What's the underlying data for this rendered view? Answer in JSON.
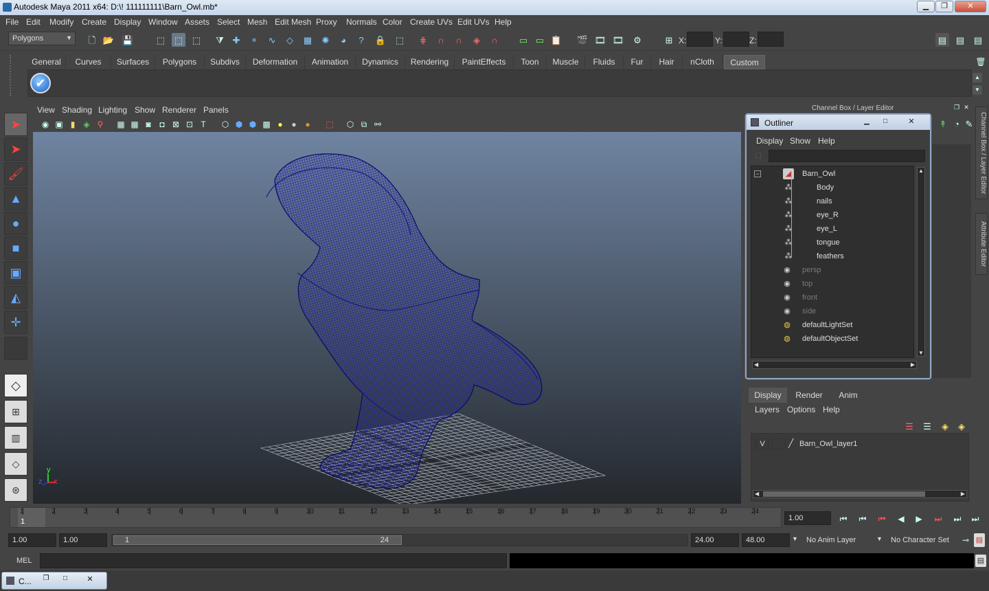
{
  "window": {
    "title": "Autodesk Maya 2011 x64: D:\\! 111111111\\Barn_Owl.mb*",
    "minimize": "▁",
    "maximize": "❐",
    "close": "✕"
  },
  "menubar": [
    "File",
    "Edit",
    "Modify",
    "Create",
    "Display",
    "Window",
    "Assets",
    "Select",
    "Mesh",
    "Edit Mesh",
    "Proxy",
    "Normals",
    "Color",
    "Create UVs",
    "Edit UVs",
    "Help"
  ],
  "statusline": {
    "mode": "Polygons",
    "x_label": "X:",
    "y_label": "Y:",
    "z_label": "Z:"
  },
  "shelf": {
    "tabs": [
      "General",
      "Curves",
      "Surfaces",
      "Polygons",
      "Subdivs",
      "Deformation",
      "Animation",
      "Dynamics",
      "Rendering",
      "PaintEffects",
      "Toon",
      "Muscle",
      "Fluids",
      "Fur",
      "Hair",
      "nCloth",
      "Custom"
    ],
    "active_tab": "Custom"
  },
  "viewport": {
    "menus": [
      "View",
      "Shading",
      "Lighting",
      "Show",
      "Renderer",
      "Panels"
    ],
    "axis_y": "y",
    "axis_x": "x",
    "axis_z": "z",
    "wire_color": "#0d0d6e"
  },
  "outliner": {
    "title": "Outliner",
    "menus": [
      "Display",
      "Show",
      "Help"
    ],
    "items": [
      {
        "label": "Barn_Owl",
        "dim": false
      },
      {
        "label": "Body",
        "dim": false
      },
      {
        "label": "nails",
        "dim": false
      },
      {
        "label": "eye_R",
        "dim": false
      },
      {
        "label": "eye_L",
        "dim": false
      },
      {
        "label": "tongue",
        "dim": false
      },
      {
        "label": "feathers",
        "dim": false
      },
      {
        "label": "persp",
        "dim": true
      },
      {
        "label": "top",
        "dim": true
      },
      {
        "label": "front",
        "dim": true
      },
      {
        "label": "side",
        "dim": true
      },
      {
        "label": "defaultLightSet",
        "dim": false
      },
      {
        "label": "defaultObjectSet",
        "dim": false
      }
    ]
  },
  "channelbox": {
    "title": "Channel Box / Layer Editor"
  },
  "sidetabs": {
    "channel": "Channel Box / Layer Editor",
    "attribute": "Attribute Editor"
  },
  "layers": {
    "tabs": [
      "Display",
      "Render",
      "Anim"
    ],
    "active": "Display",
    "menus": [
      "Layers",
      "Options",
      "Help"
    ],
    "layer": {
      "v": "V",
      "name": "Barn_Owl_layer1"
    }
  },
  "timeline": {
    "ticks": [
      "1",
      "2",
      "3",
      "4",
      "5",
      "6",
      "7",
      "8",
      "9",
      "10",
      "11",
      "12",
      "13",
      "14",
      "15",
      "16",
      "17",
      "18",
      "19",
      "20",
      "21",
      "22",
      "23",
      "24"
    ],
    "current": "1",
    "current_time": "1.00"
  },
  "range": {
    "start": "1.00",
    "playback_start": "1.00",
    "slider_start": "1",
    "slider_end": "24",
    "playback_end": "24.00",
    "end": "48.00",
    "anim_layer": "No Anim Layer",
    "character_set": "No Character Set"
  },
  "mel": {
    "label": "MEL"
  },
  "taskbar": {
    "item": "C..."
  }
}
